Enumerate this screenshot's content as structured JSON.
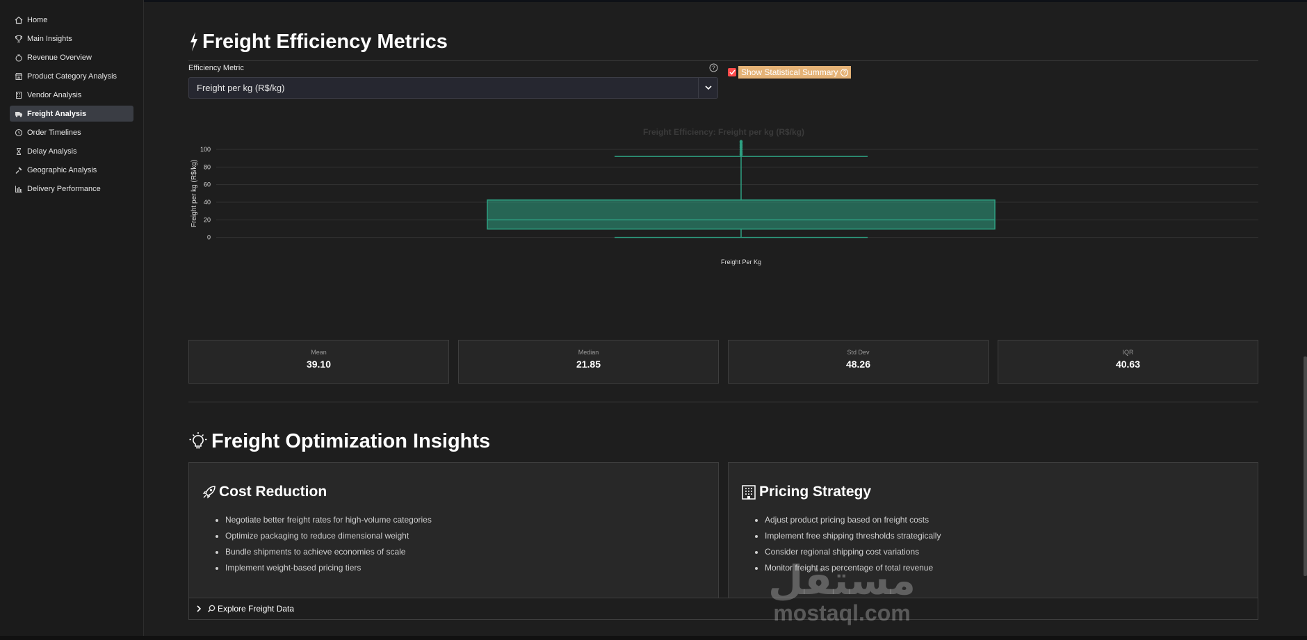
{
  "sidebar": {
    "items": [
      {
        "label": "Home",
        "icon": "home-icon"
      },
      {
        "label": "Main Insights",
        "icon": "trophy-icon"
      },
      {
        "label": "Revenue Overview",
        "icon": "money-icon"
      },
      {
        "label": "Product Category Analysis",
        "icon": "store-icon"
      },
      {
        "label": "Vendor Analysis",
        "icon": "building-icon"
      },
      {
        "label": "Freight Analysis",
        "icon": "truck-icon"
      },
      {
        "label": "Order Timelines",
        "icon": "clock-icon"
      },
      {
        "label": "Delay Analysis",
        "icon": "hourglass-icon"
      },
      {
        "label": "Geographic Analysis",
        "icon": "pin-icon"
      },
      {
        "label": "Delivery Performance",
        "icon": "bar-chart-icon"
      }
    ],
    "active_index": 5
  },
  "efficiency": {
    "title": "Freight Efficiency Metrics",
    "metric_label": "Efficiency Metric",
    "metric_value": "Freight per kg (R$/kg)",
    "summary_label": "Show Statistical Summary",
    "summary_checked": true
  },
  "chart_data": {
    "type": "box",
    "title": "Freight Efficiency: Freight per kg (R$/kg)",
    "xlabel": "",
    "ylabel": "Freight per kg (R$/kg)",
    "categories": [
      "Freight Per Kg"
    ],
    "y_ticks": [
      0,
      20,
      40,
      60,
      80,
      100
    ],
    "ylim": [
      -5,
      115
    ],
    "grid": true,
    "box": {
      "min": 0,
      "q1": 9.5,
      "median": 20,
      "q3": 42.5,
      "max": 92,
      "outliers": [
        94,
        96,
        98,
        100,
        102,
        104,
        106,
        108,
        109
      ]
    },
    "color": "#2ea082"
  },
  "stats": [
    {
      "label": "Mean",
      "value": "39.10"
    },
    {
      "label": "Median",
      "value": "21.85"
    },
    {
      "label": "Std Dev",
      "value": "48.26"
    },
    {
      "label": "IQR",
      "value": "40.63"
    }
  ],
  "insights": {
    "title": "Freight Optimization Insights",
    "cost": {
      "title": "Cost Reduction",
      "items": [
        "Negotiate better freight rates for high-volume categories",
        "Optimize packaging to reduce dimensional weight",
        "Bundle shipments to achieve economies of scale",
        "Implement weight-based pricing tiers"
      ]
    },
    "pricing": {
      "title": "Pricing Strategy",
      "items": [
        "Adjust product pricing based on freight costs",
        "Implement free shipping thresholds strategically",
        "Consider regional shipping cost variations",
        "Monitor freight as percentage of total revenue"
      ]
    }
  },
  "expander": {
    "label": "Explore Freight Data"
  },
  "watermark": {
    "arabic": "مستقل",
    "latin": "mostaql.com"
  }
}
